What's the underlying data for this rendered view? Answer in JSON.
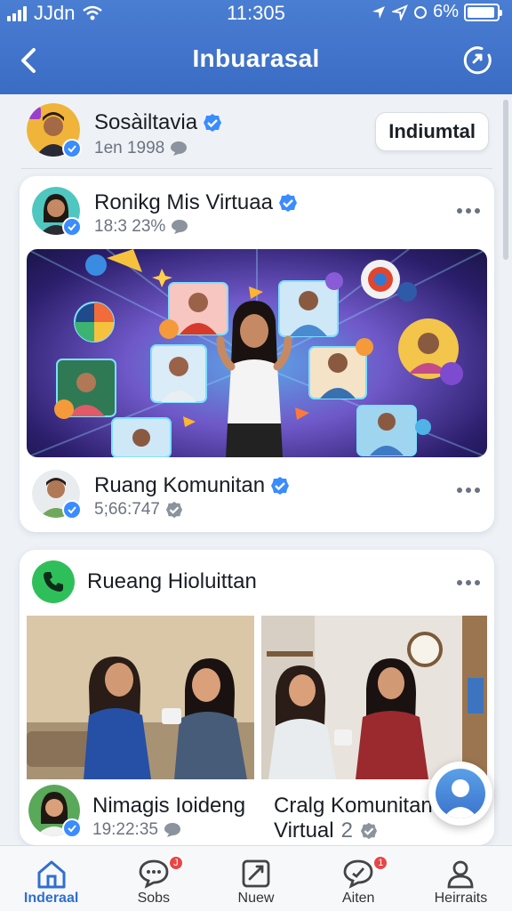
{
  "status_bar": {
    "carrier": "JJdn",
    "time": "11:305",
    "battery_percent": "6%"
  },
  "nav": {
    "title": "Inbuarasal",
    "back_icon": "chevron-left-icon",
    "action_icon": "share-circle-icon"
  },
  "profile": {
    "name": "Sosàiltavia",
    "meta": "1en 1998",
    "follow_label": "Indiumtal"
  },
  "post1": {
    "author": "Ronikg Mis Virtuaa",
    "meta": "18:3 23%",
    "footer_author": "Ruang Komunitan",
    "footer_meta": "5;66:747"
  },
  "post2": {
    "author": "Rueang Hioluittan",
    "left_caption": {
      "name": "Nimagis Ioideng",
      "meta": "19:22:35"
    },
    "right_caption": {
      "line1": "Cralg Komunitan",
      "line2": "Virtual",
      "count": "2"
    }
  },
  "tabs": [
    {
      "label": "Inderaal",
      "icon": "home-icon",
      "active": true
    },
    {
      "label": "Sobs",
      "icon": "chat-bubble-icon",
      "badge": "J"
    },
    {
      "label": "Nuew",
      "icon": "compose-icon"
    },
    {
      "label": "Aiten",
      "icon": "notification-bubble-icon",
      "badge": "1"
    },
    {
      "label": "Heirraits",
      "icon": "person-icon"
    }
  ],
  "colors": {
    "header": "#3f73c9",
    "accent": "#2f6fd0",
    "verified": "#3a8cff",
    "badge": "#e84646",
    "call_green": "#2fbf5a"
  }
}
